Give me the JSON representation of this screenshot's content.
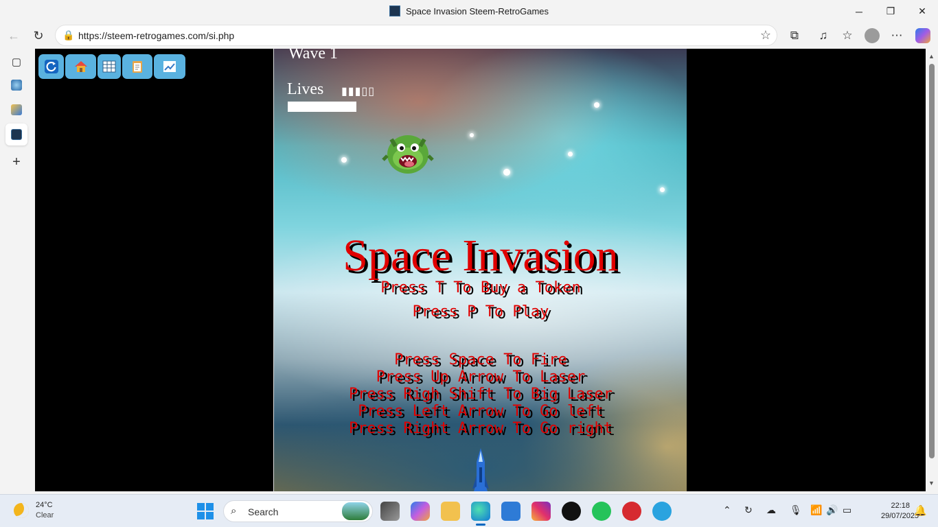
{
  "window": {
    "title": "Space Invasion Steem-RetroGames",
    "minimize": "─",
    "restore": "❐",
    "close": "✕"
  },
  "browser": {
    "url": "https://steem-retrogames.com/si.php",
    "back_icon": "←",
    "refresh_icon": "↻",
    "lock_icon": "🔒",
    "favorite_icon": "☆",
    "extensions_icon": "⧉",
    "music_icon": "♫",
    "collections_icon": "☆",
    "more_icon": "⋯"
  },
  "siderail": {
    "tabs_icon": "▢",
    "add_icon": "+"
  },
  "page_toolbar": [
    "refresh",
    "home",
    "grid",
    "notes",
    "chart"
  ],
  "game": {
    "wave_label": "Wave  1",
    "lives_label": "Lives",
    "lives_indicator": "▮▮▮▯▯",
    "title": "Space Invasion",
    "instructions": [
      "Press T To Buy a Token",
      "Press P To Play",
      "Press Space To Fire",
      "Press Up Arrow To Laser",
      "Press Righ Shift To Big Laser",
      "Press Left Arrow To Go left",
      "Press Right Arrow To Go right"
    ],
    "title_color": "#e00000"
  },
  "taskbar": {
    "weather_temp": "24°C",
    "weather_cond": "Clear",
    "search_placeholder": "Search",
    "time": "22:18",
    "date": "29/07/2025"
  }
}
